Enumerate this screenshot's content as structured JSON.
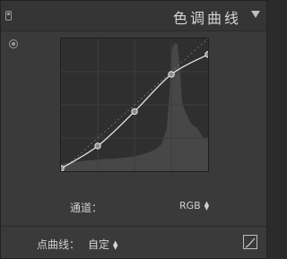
{
  "header": {
    "title": "色调曲线"
  },
  "channel": {
    "label": "通道：",
    "value": "RGB"
  },
  "point_curve": {
    "label": "点曲线：",
    "value": "自定"
  },
  "icons": {
    "panel_switch": "panel-switch-icon",
    "collapse": "triangle-down-icon",
    "target_adjust": "target-adjust-icon",
    "select_arrows": "up-down-arrows-icon",
    "edit_points": "edit-point-curve-icon"
  },
  "curve": {
    "points": [
      [
        0.0,
        0.02
      ],
      [
        0.25,
        0.19
      ],
      [
        0.5,
        0.45
      ],
      [
        0.75,
        0.73
      ],
      [
        1.0,
        0.88
      ]
    ]
  },
  "colors": {
    "panel_bg": "#3a3a3a",
    "graph_bg": "#2f2f2f",
    "curve": "#e6e6e6",
    "histogram": "#4a4a4a"
  }
}
